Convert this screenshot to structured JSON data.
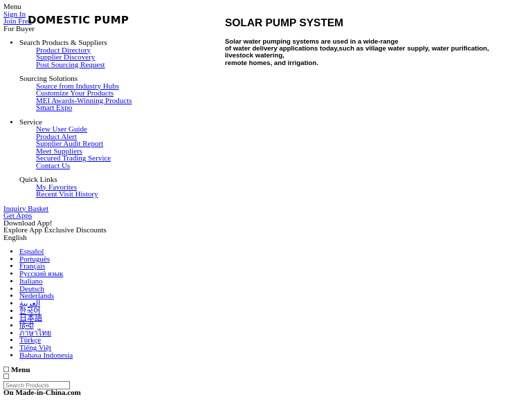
{
  "header": {
    "menu": "Menu",
    "sign_in": "Sign In",
    "join_free": "Join Free",
    "for_buyer": "For Buyer",
    "logo": "DOMESTIC PUMP"
  },
  "nav": [
    {
      "title": "Search Products & Suppliers",
      "bullet": true,
      "links": [
        "Product Directory",
        "Supplier Discovery",
        "Post Sourcing Request"
      ]
    },
    {
      "title": "Sourcing Solutions",
      "bullet": false,
      "links": [
        "Source from Industry Hubs",
        "Customize Your Products",
        "MEI Awards-Winning Products",
        "Smart Expo"
      ]
    },
    {
      "title": "Service",
      "bullet": true,
      "links": [
        "New User Guide",
        "Product Alert",
        "Supplier Audit Report",
        "Meet Suppliers",
        "Secured Trading Service",
        "Contact Us"
      ]
    },
    {
      "title": "Quick Links",
      "bullet": false,
      "links": [
        "My Favorites",
        "Recent Visit History"
      ]
    }
  ],
  "extras": {
    "inquiry_basket": "Inquiry Basket",
    "get_apps": "Get Apps",
    "download_app": "Download App!",
    "explore": "Explore App Exclusive Discounts",
    "language": "English"
  },
  "languages": [
    "Español",
    "Português",
    "Français",
    "Русский язык",
    "Italiano",
    "Deutsch",
    "Nederlands",
    "العربية",
    "한국어",
    "日本語",
    "हिन्दी",
    "ภาษาไทย",
    "Türkçe",
    "Tiếng Việt",
    "Bahasa Indonesia"
  ],
  "bottom": {
    "menu": "Menu",
    "search_placeholder": "Search Products",
    "on_site": "On Made-in-China.com"
  },
  "main": {
    "title": "SOLAR PUMP SYSTEM",
    "lines": [
      "Solar water pumping systems are used in a wide-range",
      "of water delivery applications today,such as village water supply, water purification, livestock watering,",
      "remote homes, and irrigation."
    ]
  }
}
